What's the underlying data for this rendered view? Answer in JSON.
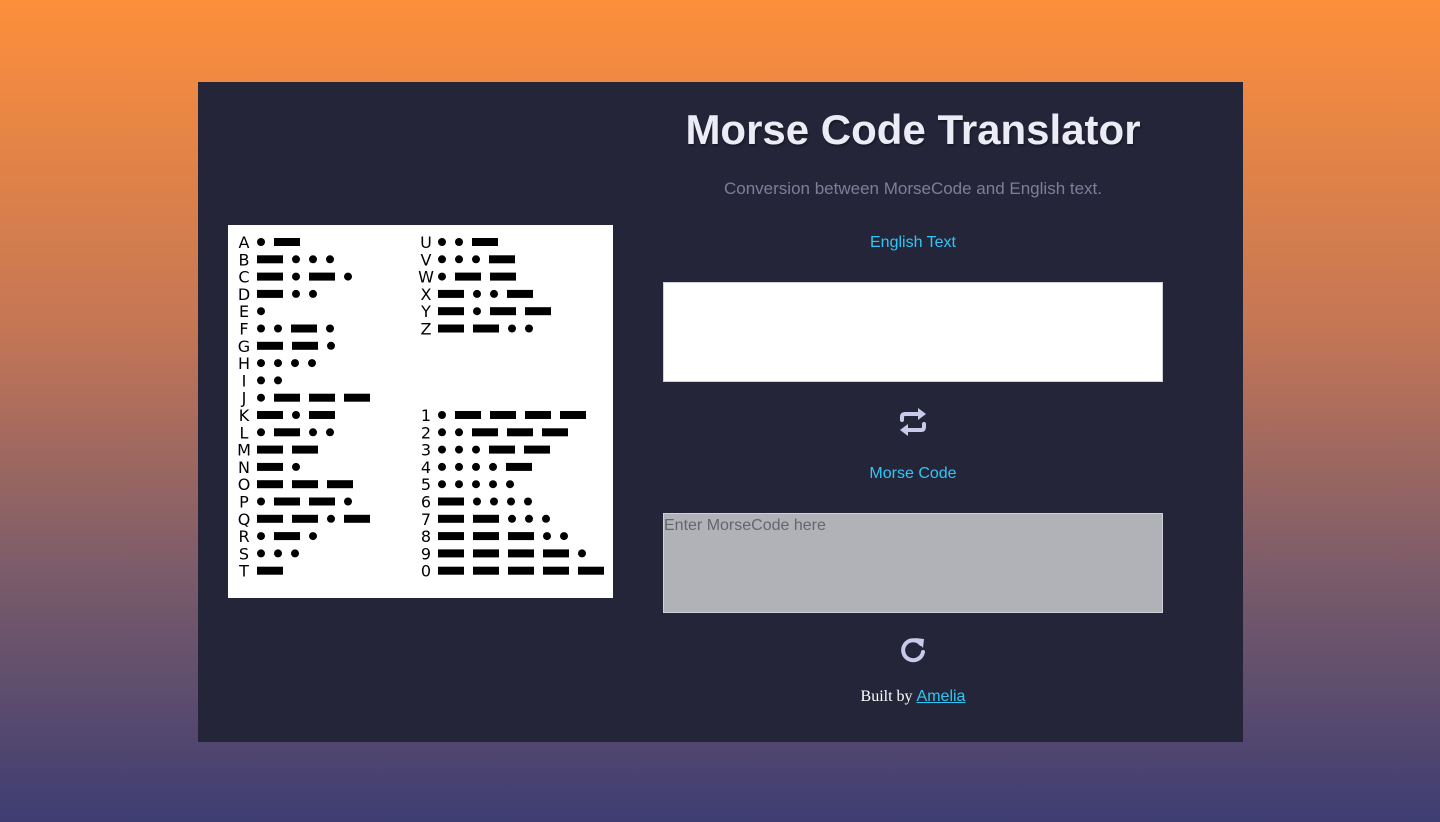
{
  "app": {
    "title": "Morse Code Translator",
    "subtitle": "Conversion between MorseCode and English text."
  },
  "english": {
    "label": "English Text",
    "value": "",
    "placeholder": ""
  },
  "morse": {
    "label": "Morse Code",
    "value": "",
    "placeholder": "Enter MorseCode here"
  },
  "controls": {
    "swap_icon": "swap-arrows-icon",
    "reset_icon": "refresh-icon"
  },
  "footer": {
    "prefix": "Built by ",
    "link_text": "Amelia"
  },
  "colors": {
    "card_bg": "#25253a",
    "accent": "#2ec7f5",
    "title": "#ececf6"
  },
  "chart_data": {
    "type": "table",
    "letters": [
      {
        "char": "A",
        "code": ".-"
      },
      {
        "char": "B",
        "code": "-..."
      },
      {
        "char": "C",
        "code": "-.-."
      },
      {
        "char": "D",
        "code": "-.."
      },
      {
        "char": "E",
        "code": "."
      },
      {
        "char": "F",
        "code": "..-."
      },
      {
        "char": "G",
        "code": "--."
      },
      {
        "char": "H",
        "code": "...."
      },
      {
        "char": "I",
        "code": ".."
      },
      {
        "char": "J",
        "code": ".---"
      },
      {
        "char": "K",
        "code": "-.-"
      },
      {
        "char": "L",
        "code": ".-.."
      },
      {
        "char": "M",
        "code": "--"
      },
      {
        "char": "N",
        "code": "-."
      },
      {
        "char": "O",
        "code": "---"
      },
      {
        "char": "P",
        "code": ".--."
      },
      {
        "char": "Q",
        "code": "--.-"
      },
      {
        "char": "R",
        "code": ".-."
      },
      {
        "char": "S",
        "code": "..."
      },
      {
        "char": "T",
        "code": "-"
      }
    ],
    "letters_right": [
      {
        "char": "U",
        "code": "..-"
      },
      {
        "char": "V",
        "code": "...-"
      },
      {
        "char": "W",
        "code": ".--"
      },
      {
        "char": "X",
        "code": "-..-"
      },
      {
        "char": "Y",
        "code": "-.--"
      },
      {
        "char": "Z",
        "code": "--.."
      }
    ],
    "digits": [
      {
        "char": "1",
        "code": ".----"
      },
      {
        "char": "2",
        "code": "..---"
      },
      {
        "char": "3",
        "code": "...--"
      },
      {
        "char": "4",
        "code": "....-"
      },
      {
        "char": "5",
        "code": "....."
      },
      {
        "char": "6",
        "code": "-...."
      },
      {
        "char": "7",
        "code": "--..."
      },
      {
        "char": "8",
        "code": "---.."
      },
      {
        "char": "9",
        "code": "----."
      },
      {
        "char": "0",
        "code": "-----"
      }
    ]
  }
}
